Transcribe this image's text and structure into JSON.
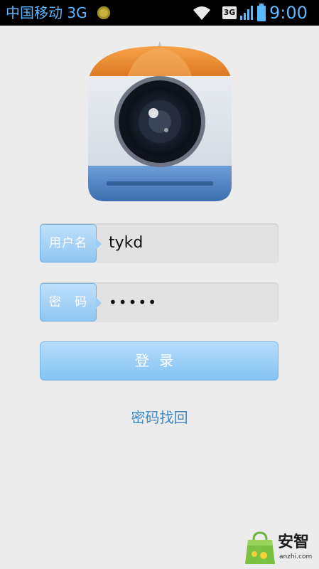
{
  "status_bar": {
    "carrier": "中国移动 3G",
    "network_type": "3G",
    "time": "9:00",
    "icons": [
      "carrier-badge-icon",
      "wifi-icon",
      "3g-icon",
      "signal-icon",
      "battery-icon"
    ]
  },
  "app": {
    "icon": "camera-umbrella-app-icon"
  },
  "form": {
    "username_label": "用户名",
    "username_value": "tykd",
    "password_label": "密　码",
    "password_value": "•••••"
  },
  "actions": {
    "login_label": "登录",
    "forgot_password_label": "密码找回"
  },
  "watermark": {
    "name": "安智",
    "domain": "anzhi.com"
  },
  "colors": {
    "accent": "#8fc6f2",
    "link": "#3e88c6",
    "status_text": "#5bb7ff",
    "background": "#ececec"
  }
}
